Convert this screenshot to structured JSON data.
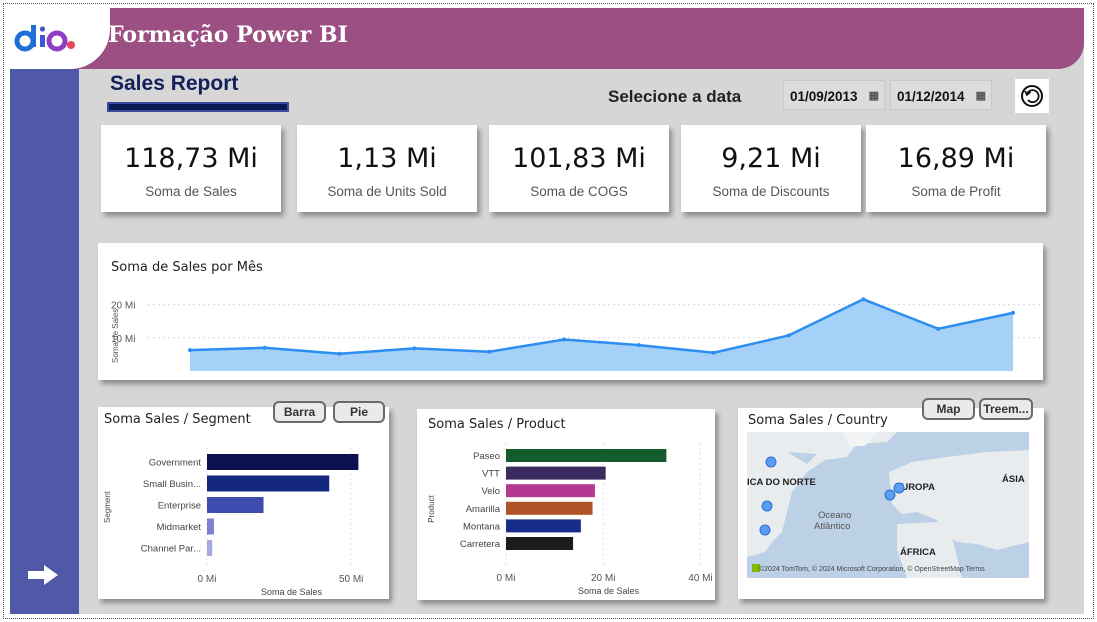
{
  "header": {
    "title": "Formação Power BI"
  },
  "report": {
    "title": "Sales Report"
  },
  "date_filter": {
    "label": "Selecione a data",
    "start": "01/09/2013",
    "end": "01/12/2014"
  },
  "kpis": [
    {
      "value": "118,73 Mi",
      "label": "Soma de  Sales"
    },
    {
      "value": "1,13 Mi",
      "label": "Soma de Units Sold"
    },
    {
      "value": "101,83 Mi",
      "label": "Soma de COGS"
    },
    {
      "value": "9,21 Mi",
      "label": "Soma de Discounts"
    },
    {
      "value": "16,89 Mi",
      "label": "Soma de Profit"
    }
  ],
  "colors": {
    "header": "#9b4f82",
    "sidebar": "#5058a8",
    "area_line": "#2b8ef0",
    "area_fill": "#a5d0f8"
  },
  "icons": {
    "reset": "reset-icon",
    "calendar": "calendar-icon",
    "next": "arrow-right-icon",
    "logo": "dio-logo"
  },
  "segment_card": {
    "title": "Soma Sales / Segment",
    "btn_bar": "Barra",
    "btn_pie": "Pie"
  },
  "product_card": {
    "title": "Soma Sales / Product"
  },
  "country_card": {
    "title": "Soma Sales / Country",
    "btn_map": "Map",
    "btn_tree": "Treem...",
    "labels": [
      "ICA DO NORTE",
      "EUROPA",
      "ÁSIA",
      "Oceano Atlântico",
      "ÁFRICA"
    ],
    "attribution": "©2024 TomTom, © 2024 Microsoft Corporation, © OpenStreetMap  Terms"
  },
  "chart_data": [
    {
      "type": "area",
      "title": "Soma de Sales por Mês",
      "ylabel": "Soma de Sales",
      "yticks": [
        "10 Mi",
        "20 Mi"
      ],
      "ylim": [
        0,
        25
      ],
      "x": [
        1,
        2,
        3,
        4,
        5,
        6,
        7,
        8,
        9,
        10,
        11,
        12
      ],
      "values": [
        6.3,
        7.0,
        5.2,
        6.8,
        5.8,
        9.5,
        7.8,
        5.5,
        10.7,
        21.6,
        12.7,
        17.5
      ]
    },
    {
      "type": "bar",
      "orientation": "horizontal",
      "title": "Soma Sales / Segment",
      "xlabel": "Soma de Sales",
      "ylabel": "Segment",
      "categories": [
        "Government",
        "Small Busin...",
        "Enterprise",
        "Midmarket",
        "Channel Par..."
      ],
      "values": [
        52.5,
        42.4,
        19.6,
        2.4,
        1.8
      ],
      "xticks": [
        "0 Mi",
        "50 Mi"
      ],
      "xlim": [
        0,
        60
      ],
      "colors": [
        "#0c1250",
        "#152880",
        "#3e4cb0",
        "#7a82cf",
        "#a4aae2"
      ]
    },
    {
      "type": "bar",
      "orientation": "horizontal",
      "title": "Soma Sales / Product",
      "xlabel": "Soma de Sales",
      "ylabel": "Product",
      "categories": [
        "Paseo",
        "VTT",
        "Velo",
        "Amarilla",
        "Montana",
        "Carretera"
      ],
      "values": [
        33.0,
        20.5,
        18.3,
        17.8,
        15.4,
        13.8
      ],
      "xticks": [
        "0 Mi",
        "20 Mi",
        "40 Mi"
      ],
      "xlim": [
        0,
        43
      ],
      "colors": [
        "#155c2c",
        "#3a2a60",
        "#b33a90",
        "#b05428",
        "#172b8a",
        "#1c1c1c"
      ]
    }
  ]
}
